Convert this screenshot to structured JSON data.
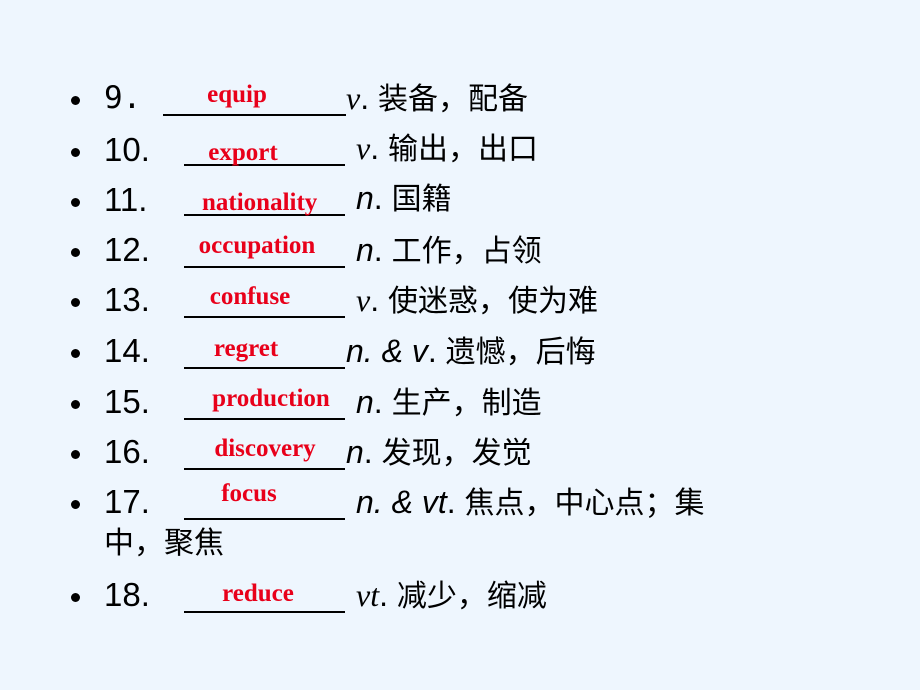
{
  "items": [
    {
      "num": "9.",
      "answer": "equip",
      "pos": "v",
      "sep": ". ",
      "meaning": "装备，配备"
    },
    {
      "num": "10.",
      "answer": "export",
      "pos": "v",
      "sep": ". ",
      "meaning": "输出，出口"
    },
    {
      "num": "11.",
      "answer": "nationality",
      "pos": "n",
      "sep": ". ",
      "meaning": "国籍"
    },
    {
      "num": "12.",
      "answer": "occupation",
      "pos": "n",
      "sep": ". ",
      "meaning": "工作，占领"
    },
    {
      "num": "13.",
      "answer": "confuse",
      "pos": "v",
      "sep": ". ",
      "meaning": "使迷惑，使为难"
    },
    {
      "num": "14.",
      "answer": "regret",
      "pos": "n. & v",
      "sep": ". ",
      "meaning": "遗憾，后悔"
    },
    {
      "num": "15.",
      "answer": "production",
      "pos": "n",
      "sep": ". ",
      "meaning": "生产，制造"
    },
    {
      "num": "16.",
      "answer": "discovery",
      "pos": "n",
      "sep": ". ",
      "meaning": "发现，发觉"
    },
    {
      "num": "17.",
      "answer": "focus",
      "pos": "n. & vt",
      "sep": ". ",
      "meaning": "焦点，中心点；集",
      "continuation": "中，聚焦"
    },
    {
      "num": "18.",
      "answer": "reduce",
      "pos": "vt",
      "sep": ". ",
      "meaning": "减少，缩减"
    }
  ]
}
